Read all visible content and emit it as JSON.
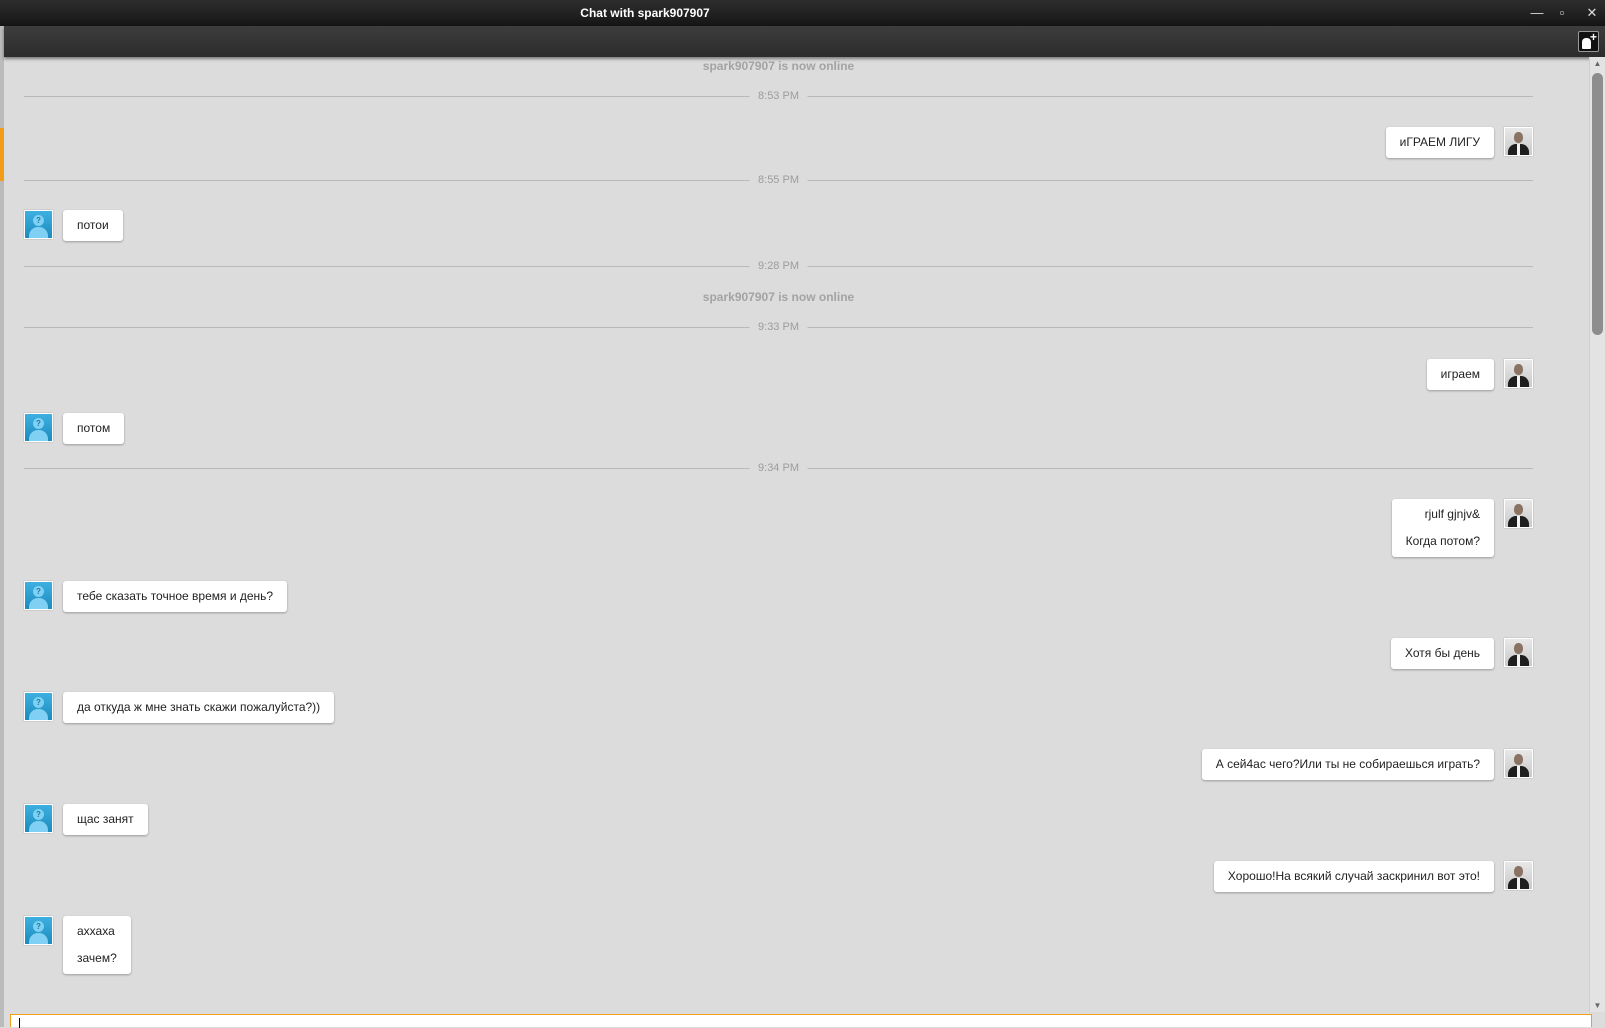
{
  "window": {
    "title": "Chat with spark907907",
    "controls": {
      "minimize": "—",
      "restore": "▫",
      "close": "✕"
    }
  },
  "toolbar": {
    "add_contact_icon": "add-user-icon"
  },
  "contact": "spark907907",
  "colors": {
    "accent": "#f39c18",
    "background": "#dcdcdc",
    "bubble": "#ffffff"
  },
  "messages": [
    {
      "type": "system",
      "text": "spark907907 is now online"
    },
    {
      "type": "separator",
      "time": "8:53 PM"
    },
    {
      "type": "outgoing",
      "lines": [
        "иГРАЕМ ЛИГУ"
      ]
    },
    {
      "type": "separator",
      "time": "8:55 PM"
    },
    {
      "type": "incoming",
      "lines": [
        "потои"
      ]
    },
    {
      "type": "separator",
      "time": "9:28 PM"
    },
    {
      "type": "system",
      "text": "spark907907 is now online"
    },
    {
      "type": "separator",
      "time": "9:33 PM"
    },
    {
      "type": "outgoing",
      "lines": [
        "играем"
      ]
    },
    {
      "type": "incoming",
      "lines": [
        "потом"
      ]
    },
    {
      "type": "separator",
      "time": "9:34 PM"
    },
    {
      "type": "outgoing",
      "lines": [
        "rjulf gjnjv&",
        "Когда потом?"
      ]
    },
    {
      "type": "incoming",
      "lines": [
        "тебе сказать точное время и день?"
      ]
    },
    {
      "type": "outgoing",
      "lines": [
        "Хотя бы день"
      ]
    },
    {
      "type": "incoming",
      "lines": [
        "да откуда ж мне знать скажи пожалуйста?))"
      ]
    },
    {
      "type": "outgoing",
      "lines": [
        "А сей4ас чего?Или ты не собираешься играть?"
      ]
    },
    {
      "type": "incoming",
      "lines": [
        "щас занят"
      ]
    },
    {
      "type": "outgoing",
      "lines": [
        "Хорошо!На всякий случай заскринил вот это!"
      ]
    },
    {
      "type": "incoming",
      "lines": [
        "аххаха",
        "зачем?"
      ]
    }
  ],
  "input": {
    "value": ""
  }
}
